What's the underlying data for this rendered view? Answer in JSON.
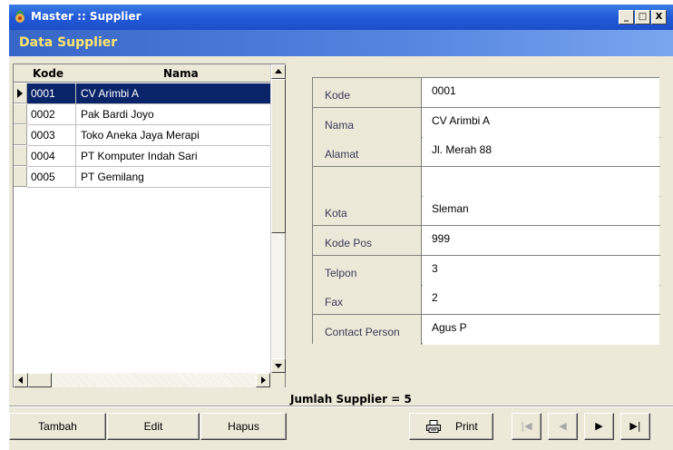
{
  "window": {
    "title": "Master :: Supplier",
    "min_label": "_",
    "max_label": "□",
    "close_label": "X"
  },
  "header": {
    "title": "Data Supplier"
  },
  "grid": {
    "columns": [
      "Kode",
      "Nama"
    ],
    "rows": [
      {
        "kode": "0001",
        "nama": "CV Arimbi A",
        "selected": true
      },
      {
        "kode": "0002",
        "nama": "Pak Bardi Joyo"
      },
      {
        "kode": "0003",
        "nama": "Toko Aneka Jaya Merapi"
      },
      {
        "kode": "0004",
        "nama": "PT Komputer Indah Sari"
      },
      {
        "kode": "0005",
        "nama": "PT Gemilang"
      }
    ]
  },
  "form": {
    "fields": [
      {
        "label": "Kode",
        "value": "0001"
      },
      {
        "label": "Nama",
        "value": "CV Arimbi A"
      },
      {
        "label": "Alamat",
        "value": "Jl. Merah 88"
      },
      {
        "label": "",
        "value": ""
      },
      {
        "label": "Kota",
        "value": "Sleman"
      },
      {
        "label": "Kode Pos",
        "value": "999"
      },
      {
        "label": "Telpon",
        "value": "3"
      },
      {
        "label": "Fax",
        "value": "2"
      },
      {
        "label": "Contact Person",
        "value": "Agus P"
      }
    ]
  },
  "summary": {
    "count_text": "Jumlah Supplier = 5"
  },
  "buttons": {
    "tambah": "Tambah",
    "edit": "Edit",
    "hapus": "Hapus",
    "print": "Print"
  },
  "nav": {
    "first": "|◀",
    "prev": "◀",
    "next": "▶",
    "last": "▶|"
  },
  "colors": {
    "titlebar": "#2259d8",
    "header_title": "#ffe66b",
    "selection": "#0a246a"
  }
}
